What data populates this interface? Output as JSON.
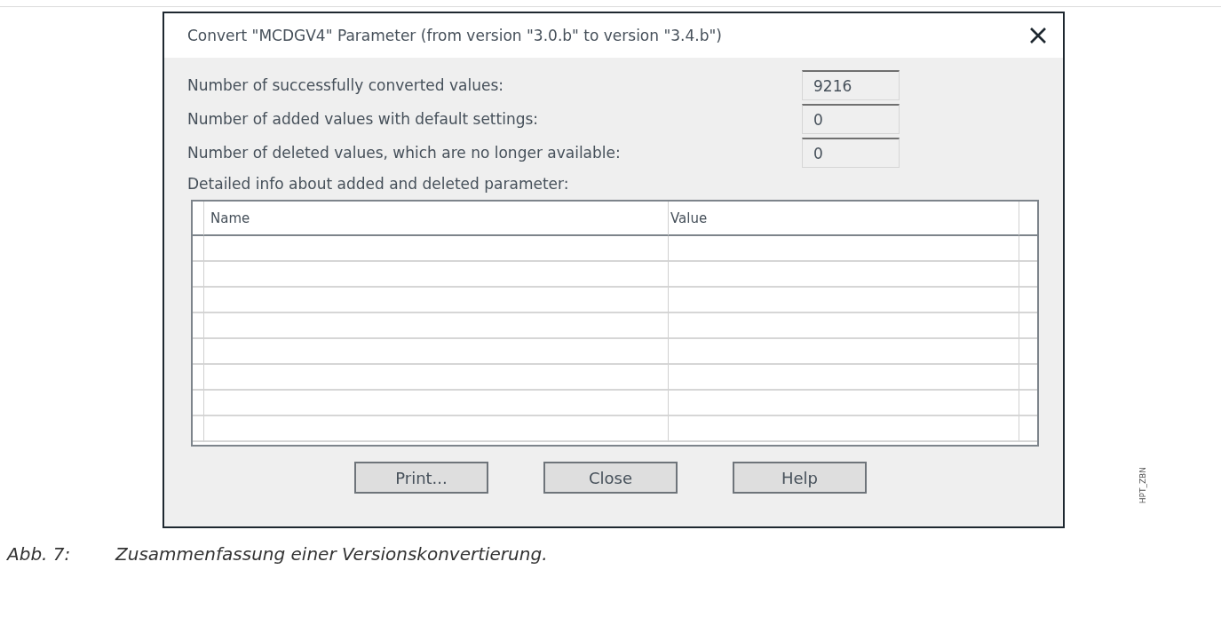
{
  "dialog": {
    "title": "Convert \"MCDGV4\" Parameter (from version \"3.0.b\" to version \"3.4.b\")",
    "stats": [
      {
        "label": "Number of successfully converted values:",
        "value": "9216"
      },
      {
        "label": "Number of added values with default settings:",
        "value": "0"
      },
      {
        "label": "Number of deleted values, which are no longer available:",
        "value": "0"
      }
    ],
    "detail_label": "Detailed info about added and deleted parameter:",
    "table": {
      "columns": [
        "Name",
        "Value"
      ]
    },
    "buttons": [
      "Print...",
      "Close",
      "Help"
    ]
  },
  "side_label": "HPT_ZBN",
  "caption": {
    "number": "Abb. 7:",
    "text": "Zusammenfassung einer Versionskonvertierung."
  }
}
